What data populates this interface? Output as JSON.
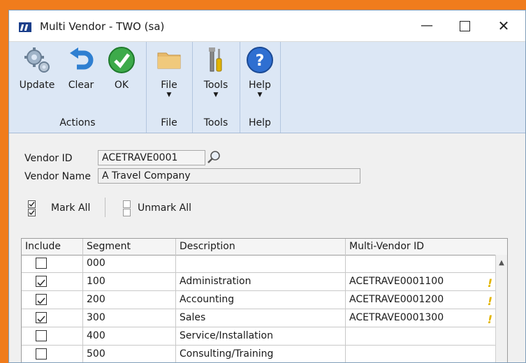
{
  "window": {
    "title": "Multi Vendor  -  TWO (sa)",
    "minimize": "—",
    "close": "✕"
  },
  "ribbon": {
    "groups": [
      {
        "label": "Actions",
        "buttons": [
          {
            "label": "Update",
            "icon": "gear-icon"
          },
          {
            "label": "Clear",
            "icon": "undo-icon"
          },
          {
            "label": "OK",
            "icon": "check-icon"
          }
        ]
      },
      {
        "label": "File",
        "buttons": [
          {
            "label": "File",
            "icon": "folder-icon"
          }
        ]
      },
      {
        "label": "Tools",
        "buttons": [
          {
            "label": "Tools",
            "icon": "tools-icon"
          }
        ]
      },
      {
        "label": "Help",
        "buttons": [
          {
            "label": "Help",
            "icon": "help-icon"
          }
        ]
      }
    ],
    "dropdown_arrow": "▼"
  },
  "form": {
    "vendor_id_label": "Vendor ID",
    "vendor_id_value": "ACETRAVE0001",
    "vendor_name_label": "Vendor Name",
    "vendor_name_value": "A Travel Company",
    "mark_all": "Mark All",
    "unmark_all": "Unmark All"
  },
  "grid": {
    "columns": [
      "Include",
      "Segment",
      "Description",
      "Multi-Vendor ID"
    ],
    "rows": [
      {
        "include": false,
        "segment": "000",
        "description": "",
        "multi_vendor_id": "",
        "warning": false
      },
      {
        "include": true,
        "segment": "100",
        "description": "Administration",
        "multi_vendor_id": "ACETRAVE0001100",
        "warning": true
      },
      {
        "include": true,
        "segment": "200",
        "description": "Accounting",
        "multi_vendor_id": "ACETRAVE0001200",
        "warning": true
      },
      {
        "include": true,
        "segment": "300",
        "description": "Sales",
        "multi_vendor_id": "ACETRAVE0001300",
        "warning": true
      },
      {
        "include": false,
        "segment": "400",
        "description": "Service/Installation",
        "multi_vendor_id": "",
        "warning": false
      },
      {
        "include": false,
        "segment": "500",
        "description": "Consulting/Training",
        "multi_vendor_id": "",
        "warning": false
      }
    ],
    "warning_glyph": "!",
    "scroll_up": "▲"
  },
  "colors": {
    "accent_border": "#f07c1c",
    "ribbon_bg": "#dce7f5"
  }
}
